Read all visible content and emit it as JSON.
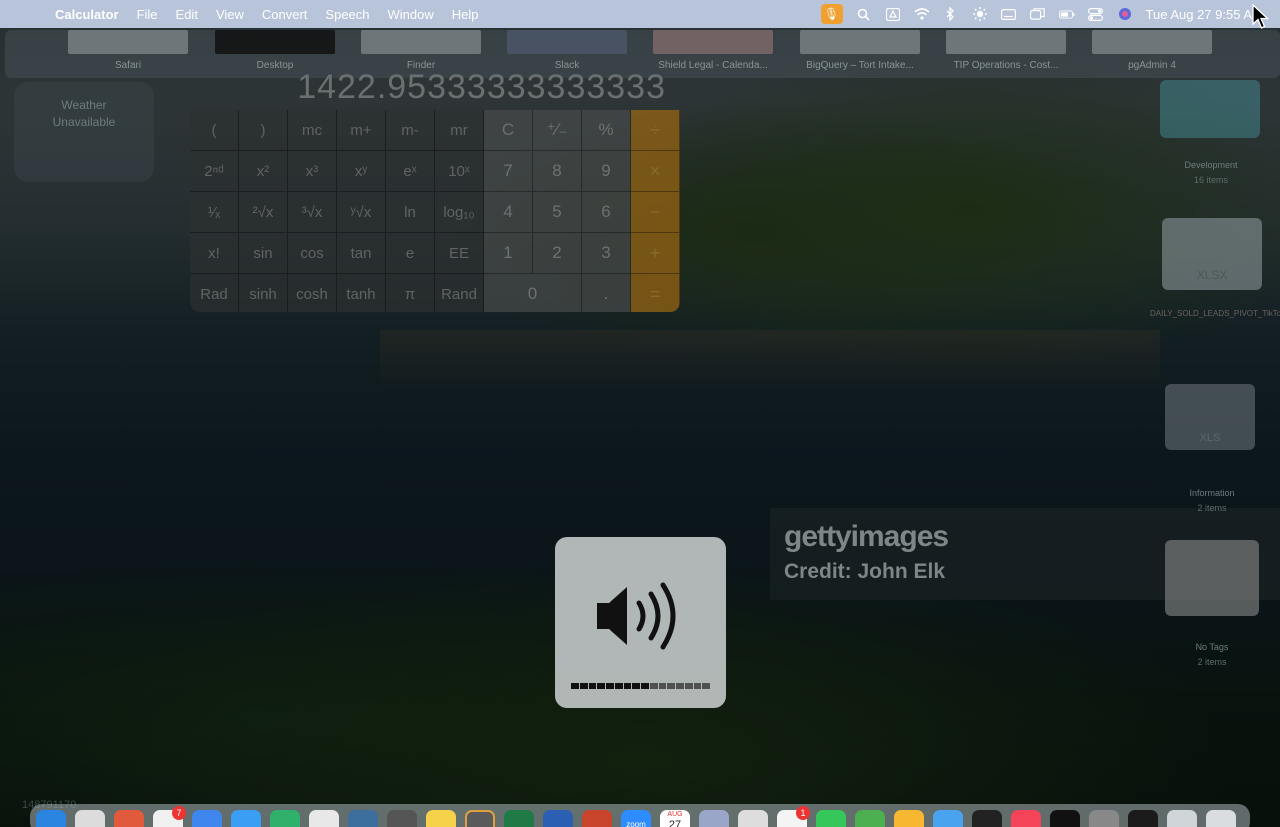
{
  "menubar": {
    "app_name": "Calculator",
    "menus": [
      "File",
      "Edit",
      "View",
      "Convert",
      "Speech",
      "Window",
      "Help"
    ],
    "clock": "Tue Aug 27  9:55 A"
  },
  "mission_control": {
    "windows": [
      "Safari",
      "Desktop",
      "Finder",
      "Slack",
      "Shield Legal - Calenda...",
      "BigQuery – Tort Intake...",
      "TIP Operations - Cost...",
      "pgAdmin 4"
    ]
  },
  "weather": {
    "line1": "Weather",
    "line2": "Unavailable"
  },
  "calculator": {
    "display": "1422.95333333333333",
    "keys": [
      [
        "(",
        ")",
        "mc",
        "m+",
        "m-",
        "mr",
        "C",
        "⁺∕₋",
        "%",
        "÷"
      ],
      [
        "2ⁿᵈ",
        "x²",
        "x³",
        "xʸ",
        "eˣ",
        "10ˣ",
        "7",
        "8",
        "9",
        "×"
      ],
      [
        "¹⁄ₓ",
        "²√x",
        "³√x",
        "ʸ√x",
        "ln",
        "log₁₀",
        "4",
        "5",
        "6",
        "−"
      ],
      [
        "x!",
        "sin",
        "cos",
        "tan",
        "e",
        "EE",
        "1",
        "2",
        "3",
        "+"
      ],
      [
        "Rad",
        "sinh",
        "cosh",
        "tanh",
        "π",
        "Rand",
        "0",
        ".",
        "="
      ]
    ]
  },
  "watermark": {
    "brand": "gettyimages",
    "credit": "Credit: John Elk"
  },
  "volume_hud": {
    "level": 0.56,
    "segments": 16
  },
  "desktop_stacks": [
    {
      "name": "Development",
      "count": "16 items"
    },
    {
      "name": "DAILY_SOLD_LEADS_PIVOT_TikTok.xlsx",
      "count": "",
      "badge": "XLSX"
    },
    {
      "name": "XLS",
      "count": ""
    },
    {
      "name": "Information",
      "count": "2 items"
    },
    {
      "name": "No Tags",
      "count": "2 items"
    }
  ],
  "bottom_number": "148791170",
  "dock": {
    "slack_badge": "7",
    "reminders_badge": "1",
    "calendar_month": "AUG",
    "calendar_day": "27",
    "zoom_label": "zoom"
  },
  "colors": {
    "menubar": "#b7c4d9",
    "calculator_operator": "#ff9f0a",
    "volume_hud": "#d2d6d6"
  }
}
